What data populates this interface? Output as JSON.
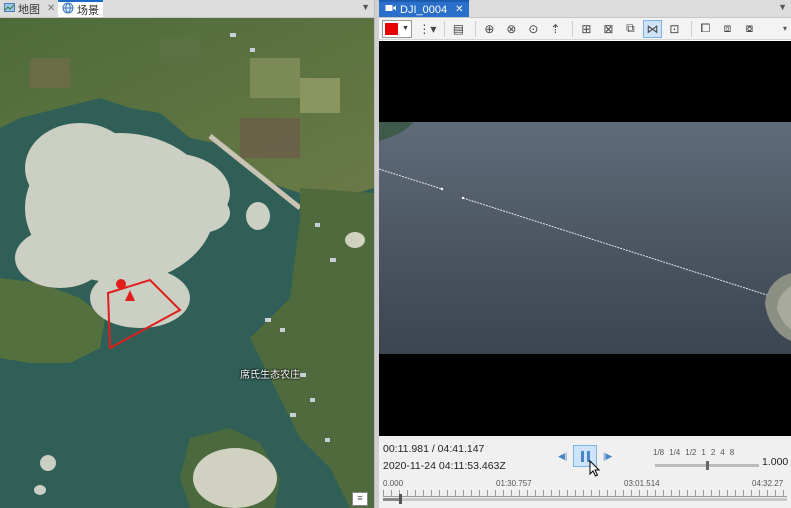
{
  "left_pane": {
    "tabs": [
      {
        "label": "地图",
        "icon": "map-icon",
        "closable": true
      },
      {
        "label": "场景",
        "icon": "globe-icon",
        "closable": false
      }
    ],
    "map": {
      "place_label": "席氏生态农庄",
      "overlay_color": "#e01e1e"
    }
  },
  "right_pane": {
    "tab": {
      "label": "DJI_0004",
      "icon": "video-icon",
      "close": "✕"
    },
    "toolbar": {
      "color": "#e80000",
      "buttons": [
        "bookmark-list-icon",
        "book-icon",
        "zoom-to-frame-icon",
        "zoom-to-footprint-icon",
        "pan-to-frame-icon",
        "north-arrow-icon",
        "add-graphic-icon",
        "delete-graphic-icon",
        "export-graphic-icon",
        "track-icon",
        "sensor-icon",
        "snapshot-icon",
        "clip-icon",
        "export-icon"
      ]
    },
    "player": {
      "current_time": "00:11.981 / 04:41.147",
      "absolute_time": "2020-11-24 04:11:53.463Z",
      "speed_options": [
        "1/8",
        "1/4",
        "1/2",
        "1",
        "2",
        "4",
        "8"
      ],
      "speed_value": "1.000",
      "speed_fraction": 0.5,
      "timeline_labels": [
        "0.000",
        "01:30.757",
        "03:01.514",
        "04:32.27"
      ],
      "progress_fraction": 0.043
    }
  },
  "colors": {
    "accent": "#2a6fc9",
    "water": "#2f5f56",
    "overlay": "#e01e1e"
  }
}
